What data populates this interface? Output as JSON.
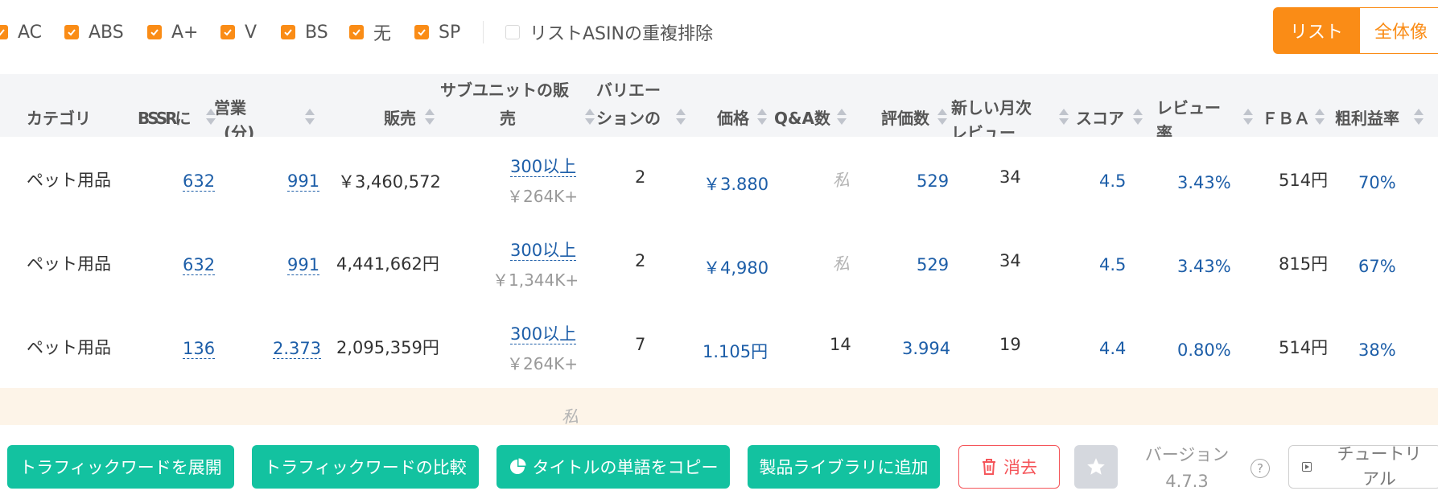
{
  "filters": {
    "items": [
      {
        "label": "AC",
        "checked": true
      },
      {
        "label": "ABS",
        "checked": true
      },
      {
        "label": "A+",
        "checked": true
      },
      {
        "label": "V",
        "checked": true
      },
      {
        "label": "BS",
        "checked": true
      },
      {
        "label": "无",
        "checked": true
      },
      {
        "label": "SP",
        "checked": true
      },
      {
        "label": "リストASINの重複排除",
        "checked": false
      }
    ]
  },
  "view_toggle": {
    "list_label": "リスト",
    "overview_label": "全体像"
  },
  "table": {
    "headers": {
      "category": "カテゴリ",
      "bsr": "BSSRに",
      "sales_vol_1": "営業",
      "sales_vol_2": "(分)",
      "revenue": "販売",
      "subunit_1": "サブユニットの販",
      "subunit_2": "売",
      "variation_1": "バリエー",
      "variation_2": "ションの",
      "price": "価格",
      "qa": "Q&A数",
      "ratings": "評価数",
      "monthly_1": "新しい月次",
      "monthly_2": "レビュー",
      "score": "スコア",
      "review_rate_1": "レビュー",
      "review_rate_2": "率",
      "fba": "ＦＢＡ",
      "margin": "粗利益率"
    },
    "rows": [
      {
        "category": "ペット用品",
        "bsr": "632",
        "sales": "991",
        "revenue": "￥3,460,572",
        "sub_main": "300以上",
        "sub_sub": "￥264K+",
        "variations": "2",
        "price": "￥3.880",
        "qa": "私",
        "ratings": "529",
        "monthly": "34",
        "score": "4.5",
        "review_rate": "3.43%",
        "fba": "514円",
        "margin": "70%"
      },
      {
        "category": "ペット用品",
        "bsr": "632",
        "sales": "991",
        "revenue": "4,441,662円",
        "sub_main": "300以上",
        "sub_sub": "￥1,344K+",
        "variations": "2",
        "price": "￥4,980",
        "qa": "私",
        "ratings": "529",
        "monthly": "34",
        "score": "4.5",
        "review_rate": "3.43%",
        "fba": "815円",
        "margin": "67%"
      },
      {
        "category": "ペット用品",
        "bsr": "136",
        "sales": "2.373",
        "revenue": "2,095,359円",
        "sub_main": "300以上",
        "sub_sub": "￥264K+",
        "variations": "7",
        "price": "1.105円",
        "qa": "14",
        "ratings": "3.994",
        "monthly": "19",
        "score": "4.4",
        "review_rate": "0.80%",
        "fba": "514円",
        "margin": "38%"
      }
    ],
    "partial_row_text": "私"
  },
  "bottom": {
    "expand_label": "トラフィックワードを展開",
    "compare_label": "トラフィックワードの比較",
    "copy_label": "タイトルの単語をコピー",
    "add_label": "製品ライブラリに追加",
    "clear_label": "消去",
    "version_label": "バージョン",
    "version_value": "4.7.3",
    "help_glyph": "?",
    "tutorial_label": "チュートリアル"
  },
  "colors": {
    "accent": "#fa8c16",
    "teal": "#13c2a0",
    "link": "#1d5ea8",
    "danger": "#f5555a"
  },
  "icons": [
    "check-icon",
    "sort-icon",
    "pie-chart-icon",
    "trash-icon",
    "star-icon",
    "help-icon",
    "play-icon"
  ]
}
